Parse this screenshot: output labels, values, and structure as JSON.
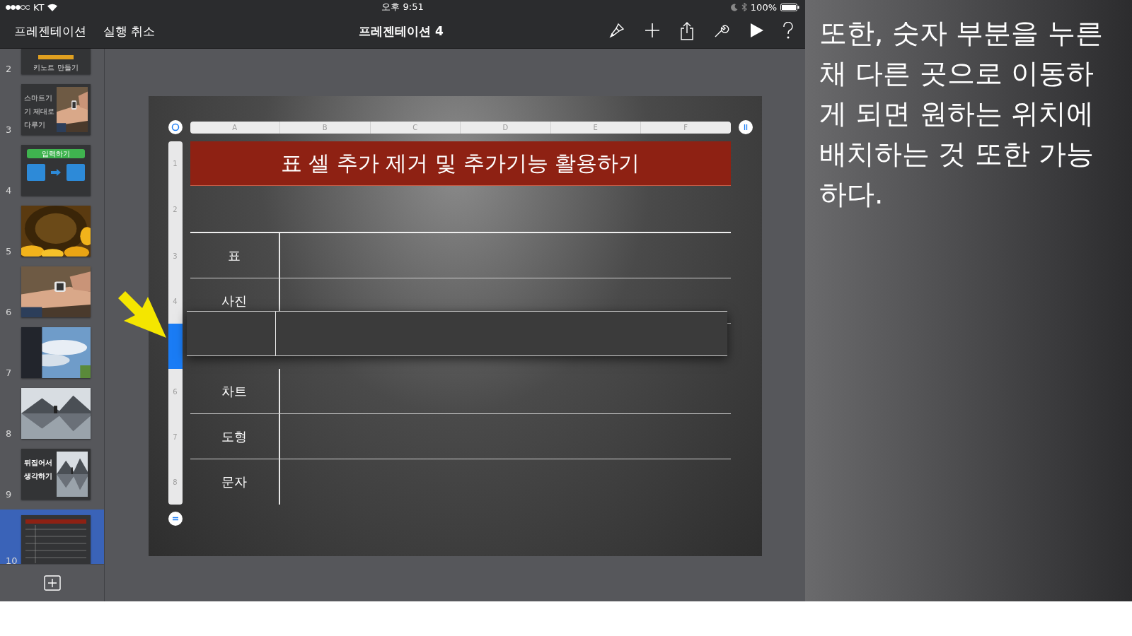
{
  "status_bar": {
    "carrier": "KT",
    "time": "오후 9:51",
    "battery": "100%"
  },
  "toolbar": {
    "left_buttons": [
      "프레젠테이션",
      "실행 취소"
    ],
    "title": "프레젠테이션 4"
  },
  "slides": [
    {
      "number": "2",
      "selected": false,
      "kind": "caption",
      "title": "키노트 만들기"
    },
    {
      "number": "3",
      "selected": false,
      "kind": "text_photo",
      "title": "스마트기기 제대로 다루기"
    },
    {
      "number": "4",
      "selected": false,
      "kind": "diagram",
      "title": "입력하기"
    },
    {
      "number": "5",
      "selected": false
    },
    {
      "number": "6",
      "selected": false
    },
    {
      "number": "7",
      "selected": false
    },
    {
      "number": "8",
      "selected": false
    },
    {
      "number": "9",
      "selected": false,
      "kind": "text_photo",
      "title": "뒤집어서 생각하기"
    },
    {
      "number": "10",
      "selected": true,
      "kind": "table"
    }
  ],
  "table": {
    "columns": [
      "A",
      "B",
      "C",
      "D",
      "E",
      "F"
    ],
    "rows": [
      {
        "number": "1",
        "kind": "title",
        "selected": false,
        "text": "표 셀 추가 제거 및 추가기능 활용하기"
      },
      {
        "number": "2",
        "kind": "blank",
        "selected": false
      },
      {
        "number": "3",
        "kind": "body",
        "selected": false,
        "label": "표"
      },
      {
        "number": "4",
        "kind": "body",
        "selected": false,
        "label": "사진"
      },
      {
        "kind": "dragging",
        "selected": true
      },
      {
        "number": "6",
        "kind": "body",
        "selected": false,
        "label": "차트"
      },
      {
        "number": "7",
        "kind": "body",
        "selected": false,
        "label": "도형"
      },
      {
        "number": "8",
        "kind": "body",
        "selected": false,
        "label": "문자"
      }
    ]
  },
  "annotation": "또한, 숫자 부분을 누른 채 다른 곳으로 이동하게 되면 원하는 위치에 배치하는 것 또한 가능하다."
}
